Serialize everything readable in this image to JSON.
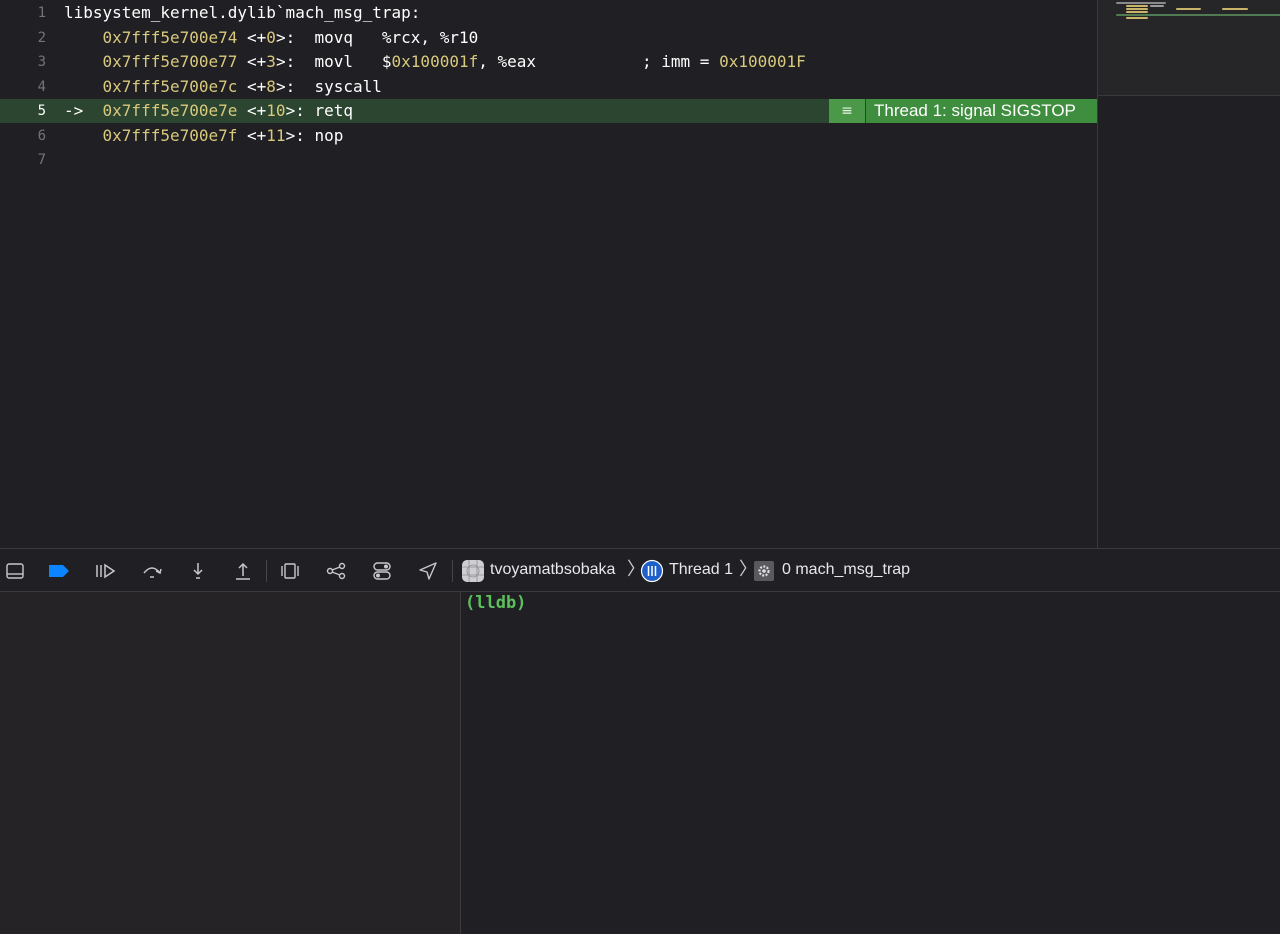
{
  "editor": {
    "lines": [
      {
        "num": "1",
        "parts": [
          {
            "t": "libsystem_kernel.dylib`mach_msg_trap:",
            "c": "plain"
          }
        ]
      },
      {
        "num": "2",
        "parts": [
          {
            "t": "    ",
            "c": "plain"
          },
          {
            "t": "0x7fff5e700e74",
            "c": "addr"
          },
          {
            "t": " <+",
            "c": "plain"
          },
          {
            "t": "0",
            "c": "num"
          },
          {
            "t": ">:  movq   %rcx, %r10",
            "c": "plain"
          }
        ]
      },
      {
        "num": "3",
        "parts": [
          {
            "t": "    ",
            "c": "plain"
          },
          {
            "t": "0x7fff5e700e77",
            "c": "addr"
          },
          {
            "t": " <+",
            "c": "plain"
          },
          {
            "t": "3",
            "c": "num"
          },
          {
            "t": ">:  movl   $",
            "c": "plain"
          },
          {
            "t": "0x100001f",
            "c": "num"
          },
          {
            "t": ", %eax           ; imm = ",
            "c": "plain"
          },
          {
            "t": "0x100001F",
            "c": "num"
          }
        ]
      },
      {
        "num": "4",
        "parts": [
          {
            "t": "    ",
            "c": "plain"
          },
          {
            "t": "0x7fff5e700e7c",
            "c": "addr"
          },
          {
            "t": " <+",
            "c": "plain"
          },
          {
            "t": "8",
            "c": "num"
          },
          {
            "t": ">:  syscall",
            "c": "plain"
          }
        ]
      },
      {
        "num": "5",
        "current": true,
        "parts": [
          {
            "t": "->  ",
            "c": "plain"
          },
          {
            "t": "0x7fff5e700e7e",
            "c": "addr"
          },
          {
            "t": " <+",
            "c": "plain"
          },
          {
            "t": "10",
            "c": "num"
          },
          {
            "t": ">: retq",
            "c": "plain"
          }
        ]
      },
      {
        "num": "6",
        "parts": [
          {
            "t": "    ",
            "c": "plain"
          },
          {
            "t": "0x7fff5e700e7f",
            "c": "addr"
          },
          {
            "t": " <+",
            "c": "plain"
          },
          {
            "t": "11",
            "c": "num"
          },
          {
            "t": ">: nop",
            "c": "plain"
          }
        ]
      },
      {
        "num": "7",
        "parts": []
      }
    ],
    "thread_badge": "Thread 1: signal SIGSTOP"
  },
  "colors": {
    "current_line": "#2b4530",
    "badge": "#3f8d3f",
    "address": "#d9c97c",
    "prompt": "#5cc05c",
    "accent": "#0a84ff"
  },
  "toolbar": {
    "buttons": [
      {
        "name": "hide-debug-area-button",
        "icon": "panel-bottom-icon"
      },
      {
        "name": "breakpoints-toggle-button",
        "icon": "breakpoint-icon",
        "active": true
      },
      {
        "name": "continue-button",
        "icon": "continue-icon"
      },
      {
        "name": "step-over-button",
        "icon": "step-over-icon"
      },
      {
        "name": "step-into-button",
        "icon": "step-into-icon"
      },
      {
        "name": "step-out-button",
        "icon": "step-out-icon"
      },
      {
        "name": "view-hierarchy-button",
        "icon": "view-hierarchy-icon"
      },
      {
        "name": "memory-graph-button",
        "icon": "memory-graph-icon"
      },
      {
        "name": "environment-overrides-button",
        "icon": "toggles-icon"
      },
      {
        "name": "simulate-location-button",
        "icon": "location-arrow-icon"
      }
    ],
    "breadcrumb": {
      "app": "tvoyamatbsobaka",
      "thread": "Thread 1",
      "frame": "0 mach_msg_trap"
    }
  },
  "console": {
    "prompt": "(lldb)"
  }
}
